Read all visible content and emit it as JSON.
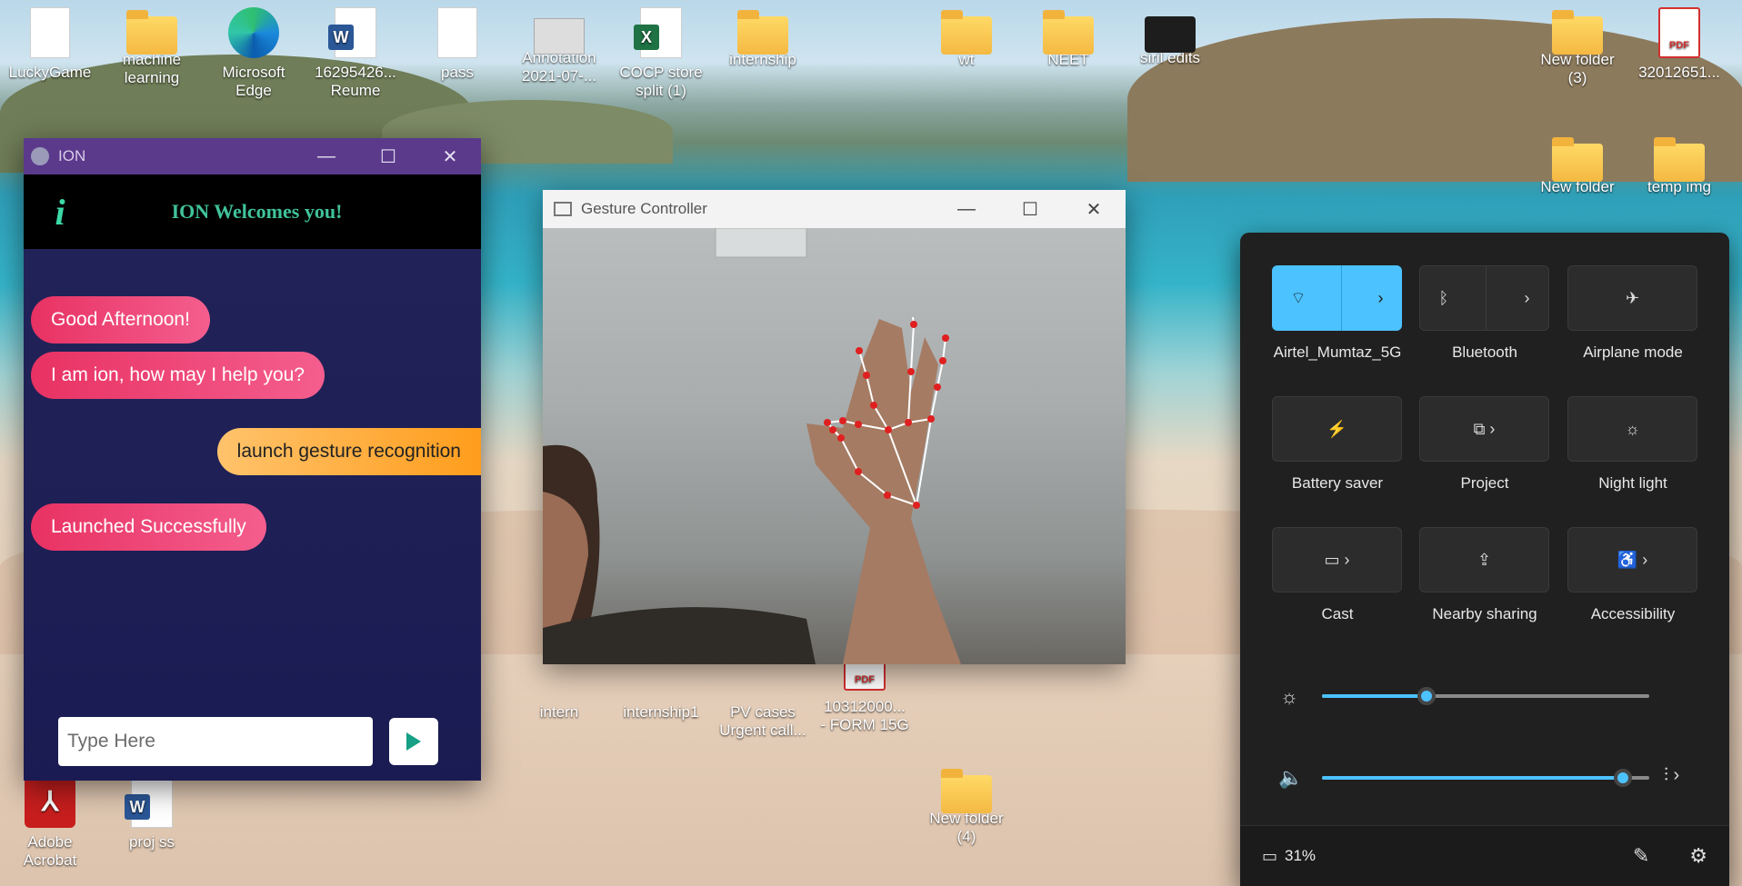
{
  "desktop": {
    "icons": [
      {
        "label": "LuckyGame",
        "icon": "document-icon"
      },
      {
        "label": "machine\nlearning",
        "icon": "folder-icon"
      },
      {
        "label": "Microsoft\nEdge",
        "icon": "edge-icon"
      },
      {
        "label": "16295426...\nReume",
        "icon": "word-icon"
      },
      {
        "label": "pass",
        "icon": "document-icon"
      },
      {
        "label": "Annotation\n2021-07-...",
        "icon": "image-icon"
      },
      {
        "label": "COCP store\nsplit (1)",
        "icon": "excel-icon"
      },
      {
        "label": "internship",
        "icon": "chrome-folder-icon"
      },
      {
        "label": "wt",
        "icon": "chrome-folder-icon"
      },
      {
        "label": "NEET",
        "icon": "folder-icon"
      },
      {
        "label": "siril edits",
        "icon": "image-icon"
      },
      {
        "label": "New folder\n(3)",
        "icon": "folder-icon"
      },
      {
        "label": "32012651...",
        "icon": "pdf-icon"
      },
      {
        "label": "New folder",
        "icon": "folder-icon"
      },
      {
        "label": "temp img",
        "icon": "folder-icon"
      },
      {
        "label": "intern",
        "icon": "folder-icon"
      },
      {
        "label": "internship1",
        "icon": "folder-icon"
      },
      {
        "label": "PV cases\nUrgent call...",
        "icon": "excel-icon"
      },
      {
        "label": "10312000...\n- FORM 15G",
        "icon": "pdf-icon"
      },
      {
        "label": "New folder\n(4)",
        "icon": "folder-icon"
      },
      {
        "label": "Adobe\nAcrobat",
        "icon": "acrobat-icon"
      },
      {
        "label": "proj ss",
        "icon": "word-icon"
      }
    ]
  },
  "ion": {
    "window_title": "ION",
    "logo": "i",
    "welcome": "ION Welcomes you!",
    "messages": [
      {
        "from": "bot",
        "text": "Good Afternoon!"
      },
      {
        "from": "bot",
        "text": "I am ion, how may I help you?"
      },
      {
        "from": "user",
        "text": "launch gesture recognition"
      },
      {
        "from": "bot",
        "text": "Launched Successfully"
      }
    ],
    "input_placeholder": "Type Here"
  },
  "gesture": {
    "window_title": "Gesture Controller"
  },
  "quick_settings": {
    "accent": "#4cc2ff",
    "tiles": [
      {
        "label": "Airtel_Mumtaz_5G",
        "icon": "wifi-icon",
        "active": true
      },
      {
        "label": "Bluetooth",
        "icon": "bluetooth-icon",
        "active": false
      },
      {
        "label": "Airplane mode",
        "icon": "airplane-icon",
        "active": false
      },
      {
        "label": "Battery saver",
        "icon": "battery-saver-icon",
        "active": false
      },
      {
        "label": "Project",
        "icon": "project-icon",
        "active": false
      },
      {
        "label": "Night light",
        "icon": "night-light-icon",
        "active": false
      },
      {
        "label": "Cast",
        "icon": "cast-icon",
        "active": false
      },
      {
        "label": "Nearby sharing",
        "icon": "share-icon",
        "active": false
      },
      {
        "label": "Accessibility",
        "icon": "accessibility-icon",
        "active": false
      }
    ],
    "brightness_level": 0.32,
    "volume_level": 0.92,
    "battery": "31%"
  }
}
